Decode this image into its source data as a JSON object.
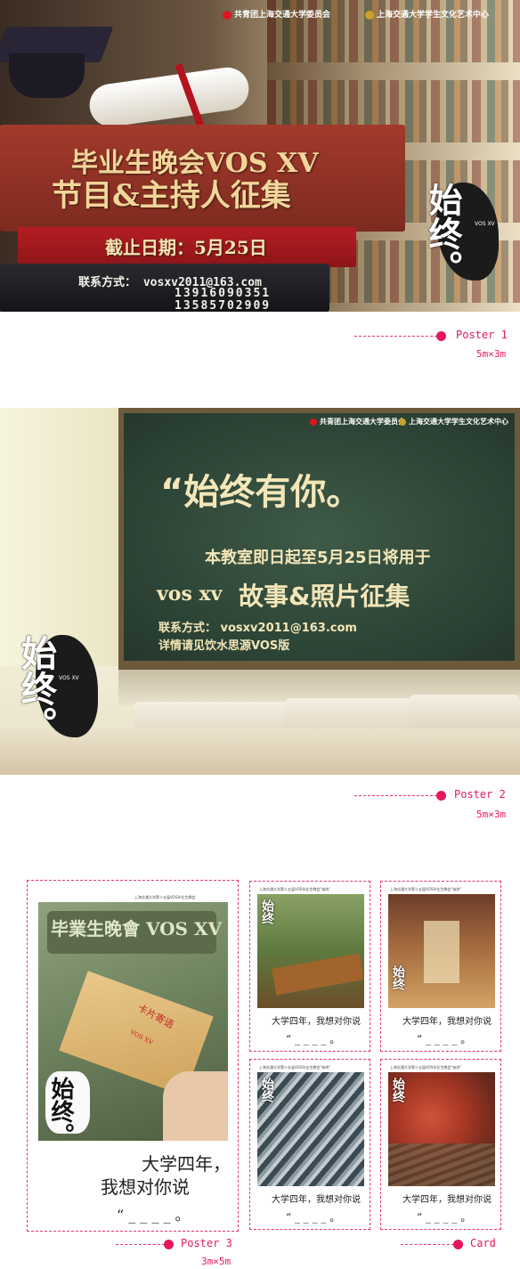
{
  "poster1": {
    "header_left": "共青团上海交通大学委员会",
    "header_right": "上海交通大学学生文化艺术中心",
    "title_line1": "毕业生晚会VOS XV",
    "title_line2": "节目&主持人征集",
    "deadline": "截止日期：5月25日",
    "contact_label": "联系方式：",
    "email": "vosxv2011@163.com",
    "phone1": "13916090351",
    "phone2": "13585702909",
    "brand_text": "始终。",
    "brand_small": "VOS XV"
  },
  "label1": {
    "name": "Poster 1",
    "size": "5m×3m"
  },
  "poster2": {
    "header_left": "共青团上海交通大学委员会",
    "header_right": "上海交通大学学生文化艺术中心",
    "headline": "“始终有你。",
    "notice": "本教室即日起至5月25日将用于",
    "vos": "vos xv",
    "collect": "故事&照片征集",
    "contact": "联系方式：  vosxv2011@163.com",
    "detail": "详情请见饮水思源VOS版",
    "brand_text": "始终。",
    "brand_small": "VOS XV"
  },
  "label2": {
    "name": "Poster 2",
    "size": "5m×3m"
  },
  "poster3": {
    "header": "上海交通大学第十五届VOS毕业生晚会",
    "mailbox_text": "毕業生晚會 VOS XV",
    "card_title": "卡片寄语",
    "card_sub": "VOS XV",
    "brand_text": "始终。",
    "hand_line1": "大学四年，",
    "hand_line2": "我想对你说",
    "quote": "“ _ _ _ _ 。"
  },
  "label3": {
    "name": "Poster 3",
    "size": "3m×5m"
  },
  "cards": [
    {
      "header": "上海交通大学第十五届VOS毕业生晚会“始终”",
      "brand": "始终",
      "hand": "大学四年，我想对你说",
      "quote": "“ _ _ _ _ 。"
    },
    {
      "header": "上海交通大学第十五届VOS毕业生晚会“始终”",
      "brand": "始终",
      "hand": "大学四年，我想对你说",
      "quote": "“ _ _ _ _ 。"
    },
    {
      "header": "上海交通大学第十五届VOS毕业生晚会“始终”",
      "brand": "始终",
      "hand": "大学四年，我想对你说",
      "quote": "“ _ _ _ _ 。"
    },
    {
      "header": "上海交通大学第十五届VOS毕业生晚会“始终”",
      "brand": "始终",
      "hand": "大学四年，我想对你说",
      "quote": "“ _ _ _ _ 。"
    }
  ],
  "label4": {
    "name": "Card"
  },
  "colors": {
    "accent": "#e5175f"
  }
}
